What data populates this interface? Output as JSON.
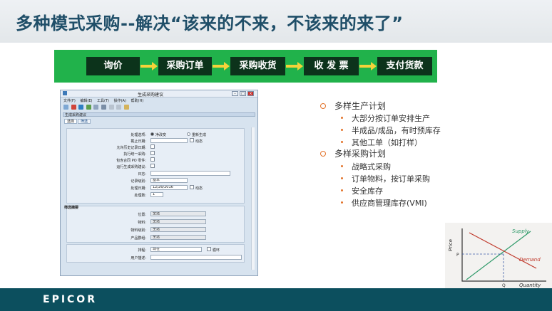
{
  "slide": {
    "title": "多种模式采购--解决“该来的不来，不该来的来了”",
    "process_steps": [
      "询价",
      "采购订单",
      "采购收货",
      "收 发 票",
      "支付货款"
    ],
    "bullets": [
      {
        "text": "多样生产计划",
        "children": [
          "大部分按订单安排生产",
          "半成品/成品，有时预库存",
          "其他工单（如打样）"
        ]
      },
      {
        "text": "多样采购计划",
        "children": [
          "战略式采购",
          "订单物料，按订单采购",
          "安全库存",
          "供应商管理库存(VMI)"
        ]
      }
    ],
    "footer_logo": "EPICOR"
  },
  "app_window": {
    "title": "生成采购建议",
    "menu": [
      "文件(F)",
      "编辑(E)",
      "工具(T)",
      "操作(A)",
      "帮助(H)"
    ],
    "panel_title": "生成采购建议",
    "tabs": [
      "选择",
      "筛选"
    ],
    "form": {
      "mode_label": "处理选项:",
      "mode_options": [
        "净改变",
        "重新生成"
      ],
      "cutoff_label": "截止日期:",
      "dynamic": "动态",
      "allow_history_label": "允许历史记录日期:",
      "unified_label": "执行统一采购:",
      "include_po_label": "包含合同 PO 零件:",
      "run_mrp_label": "运行生成采购建议:",
      "log_label": "日志:",
      "level_label": "记录级别:",
      "level_value": "基本",
      "proc_date_label": "处理日期:",
      "proc_date_value": "12/26/2016",
      "cycles_label": "处理数:",
      "cycles_value": "1"
    },
    "filter_group": {
      "title": "筛选摘要",
      "rows": [
        {
          "label": "位置:",
          "value": "全选"
        },
        {
          "label": "物料:",
          "value": "全选"
        },
        {
          "label": "物料级别:",
          "value": "全选"
        },
        {
          "label": "产品群组:",
          "value": "全选"
        }
      ]
    },
    "schedule": {
      "label": "排程:",
      "value": "现在",
      "recur": "循环",
      "user_desc_label": "用户描述:"
    }
  },
  "supply_demand_chart": {
    "xlabel": "Quantity",
    "ylabel": "Price",
    "curves": [
      "Supply",
      "Demand"
    ],
    "points": [
      "P",
      "Q"
    ],
    "colors": {
      "supply": "#2f9a6a",
      "demand": "#c0392b"
    }
  },
  "colors": {
    "title": "#1f4e68",
    "flow_bg": "#21b24b",
    "flow_box": "#0c331b",
    "arrow": "#f5d33a",
    "bullet": "#e3732b",
    "footer": "#0c4f5e"
  }
}
